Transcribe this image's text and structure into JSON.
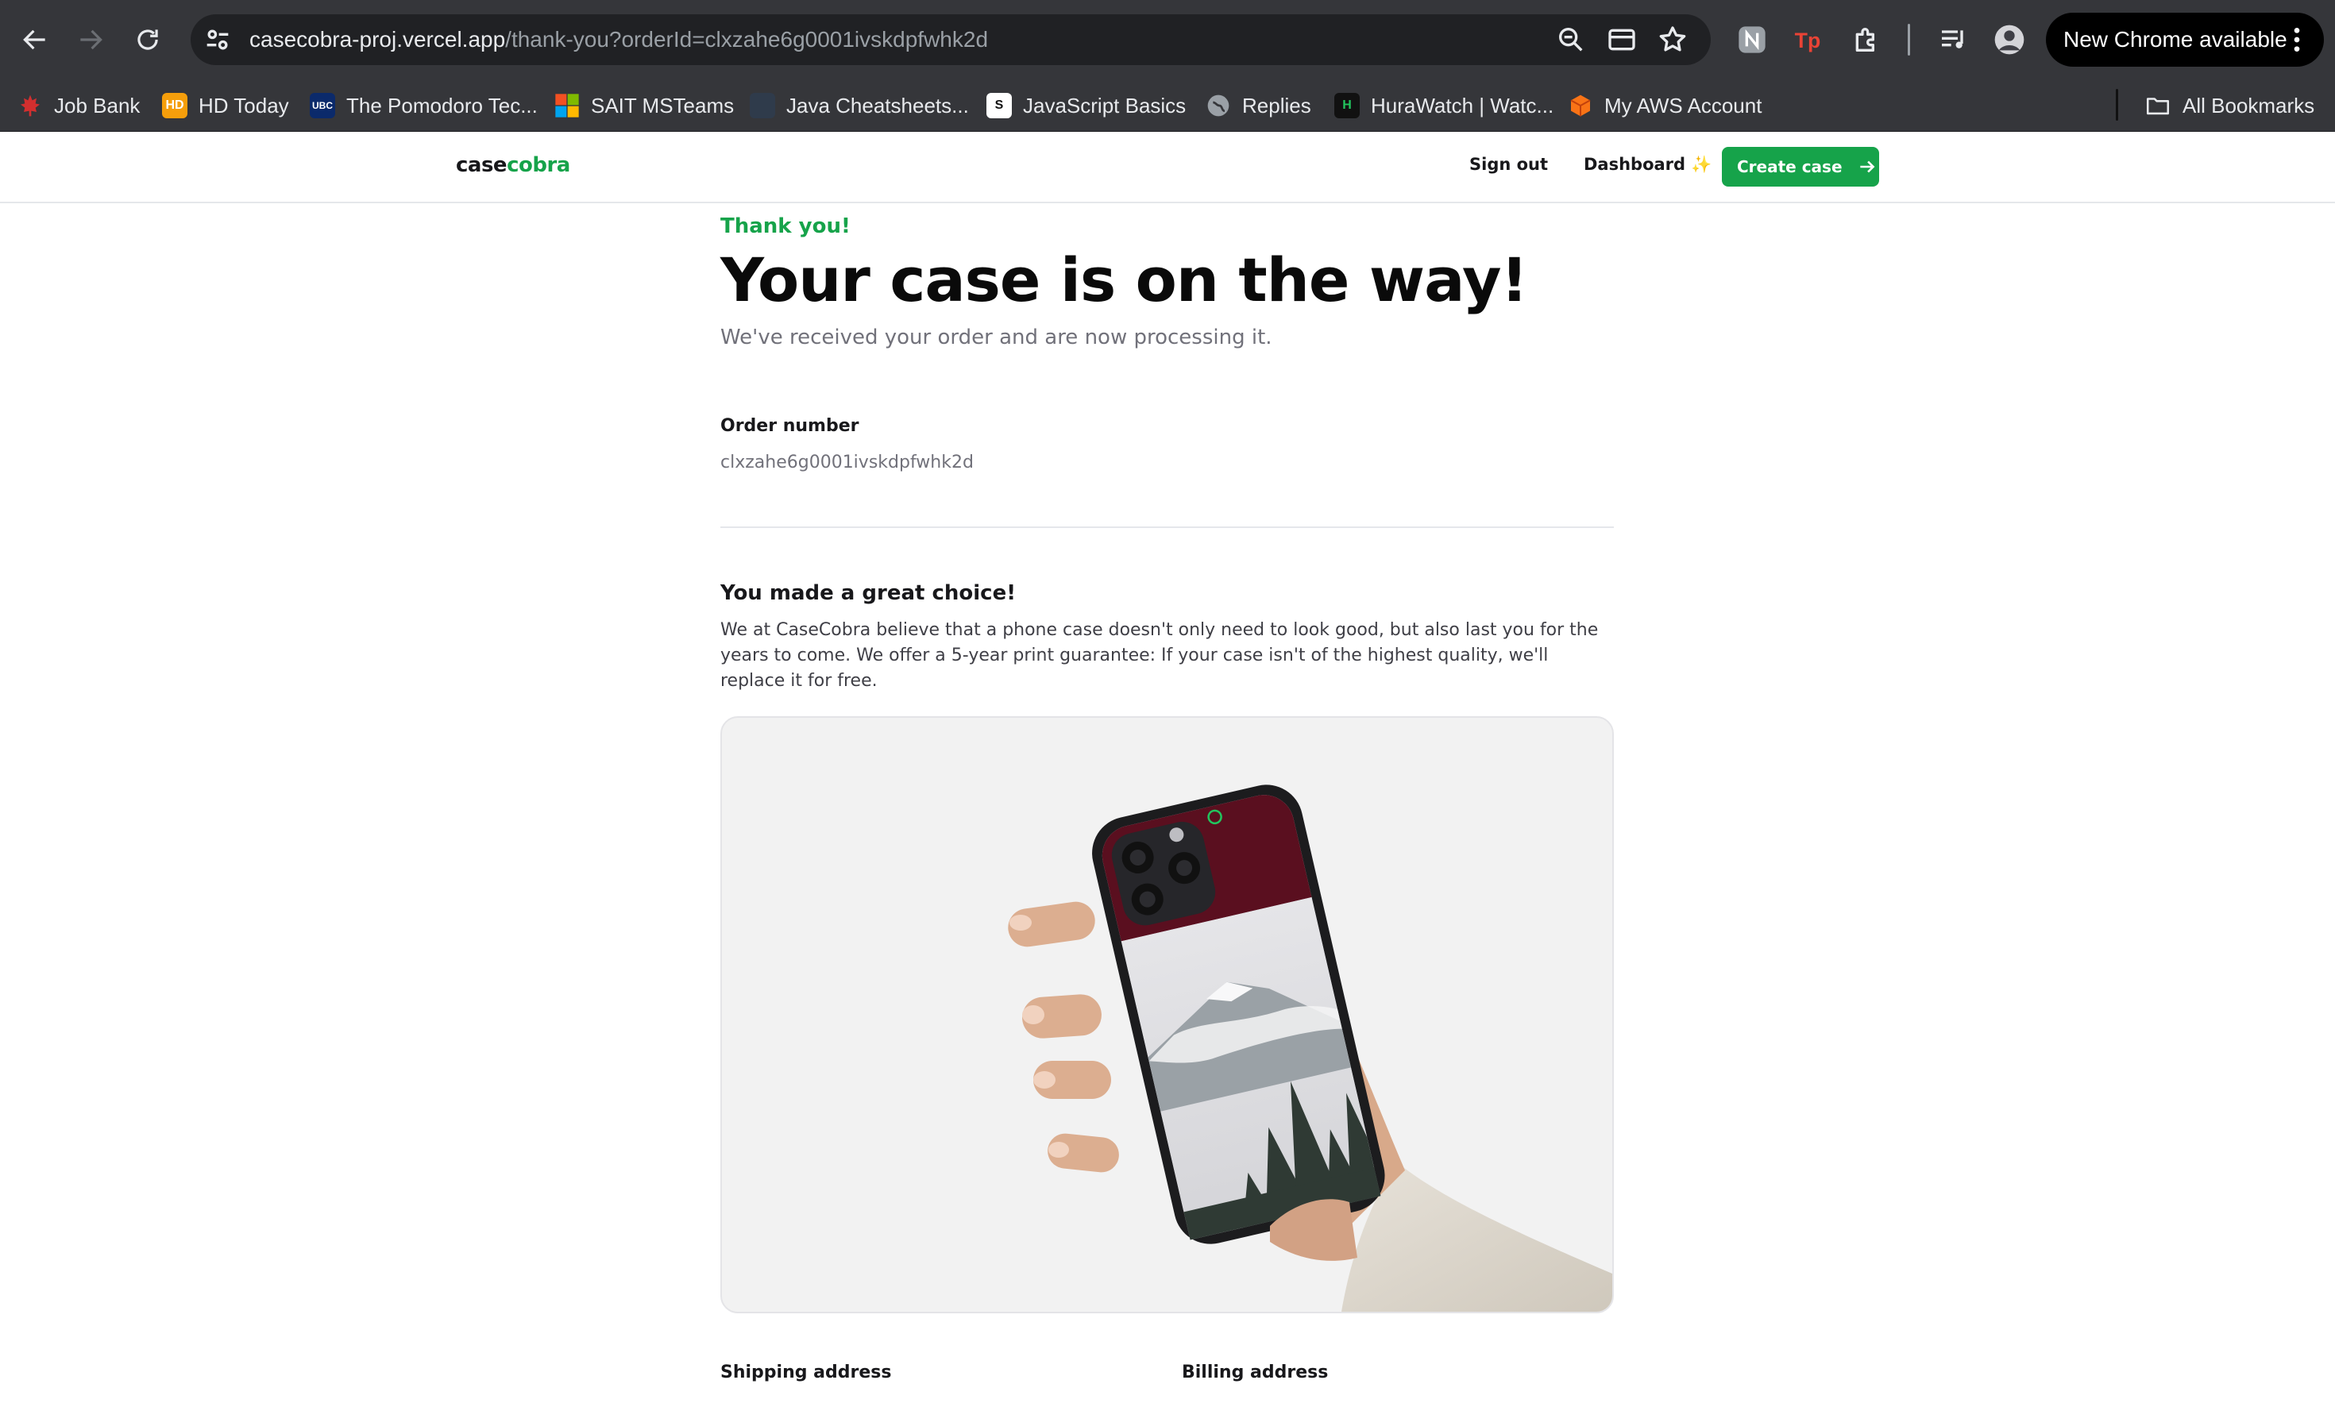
{
  "browser": {
    "url_host": "casecobra-proj.vercel.app",
    "url_path": "/thank-you?orderId=clxzahe6g0001ivskdpfwhk2d",
    "update_label": "New Chrome available",
    "bookmarks": [
      {
        "label": "Job Bank",
        "icon": "maple-leaf-icon",
        "color": "#d32f2f",
        "glyph": "🍁"
      },
      {
        "label": "HD Today",
        "icon": "hd-today-icon",
        "color": "#f59e0b",
        "glyph": "HD"
      },
      {
        "label": "The Pomodoro Tec...",
        "icon": "ubc-icon",
        "color": "#0b2a6b",
        "glyph": "UBC"
      },
      {
        "label": "SAIT MSTeams",
        "icon": "microsoft-icon",
        "color": "#35363a",
        "glyph": ""
      },
      {
        "label": "Java Cheatsheets...",
        "icon": "java-icon",
        "color": "#2f3b4b",
        "glyph": ""
      },
      {
        "label": "JavaScript Basics",
        "icon": "javascript-icon",
        "color": "#ffffff",
        "glyph": "S"
      },
      {
        "label": "Replies",
        "icon": "globe-icon",
        "color": "#5f6368",
        "glyph": ""
      },
      {
        "label": "HuraWatch | Watc...",
        "icon": "hurawatch-icon",
        "color": "#111111",
        "glyph": "H"
      },
      {
        "label": "My AWS Account",
        "icon": "aws-icon",
        "color": "#f97316",
        "glyph": ""
      }
    ],
    "all_bookmarks_label": "All Bookmarks"
  },
  "nav": {
    "logo_primary": "case",
    "logo_accent": "cobra",
    "sign_out": "Sign out",
    "dashboard": "Dashboard ✨",
    "create_case": "Create case"
  },
  "main": {
    "eyebrow": "Thank you!",
    "title": "Your case is on the way!",
    "subtitle": "We've received your order and are now processing it.",
    "order_label": "Order number",
    "order_id": "clxzahe6g0001ivskdpfwhk2d",
    "choice_title": "You made a great choice!",
    "choice_body": "We at CaseCobra believe that a phone case doesn't only need to look good, but also last you for the years to come. We offer a 5-year print guarantee: If your case isn't of the highest quality, we'll replace it for free.",
    "shipping_label": "Shipping address",
    "billing_label": "Billing address"
  },
  "colors": {
    "accent": "#16a34a",
    "case_top": "#5a0f1f"
  }
}
